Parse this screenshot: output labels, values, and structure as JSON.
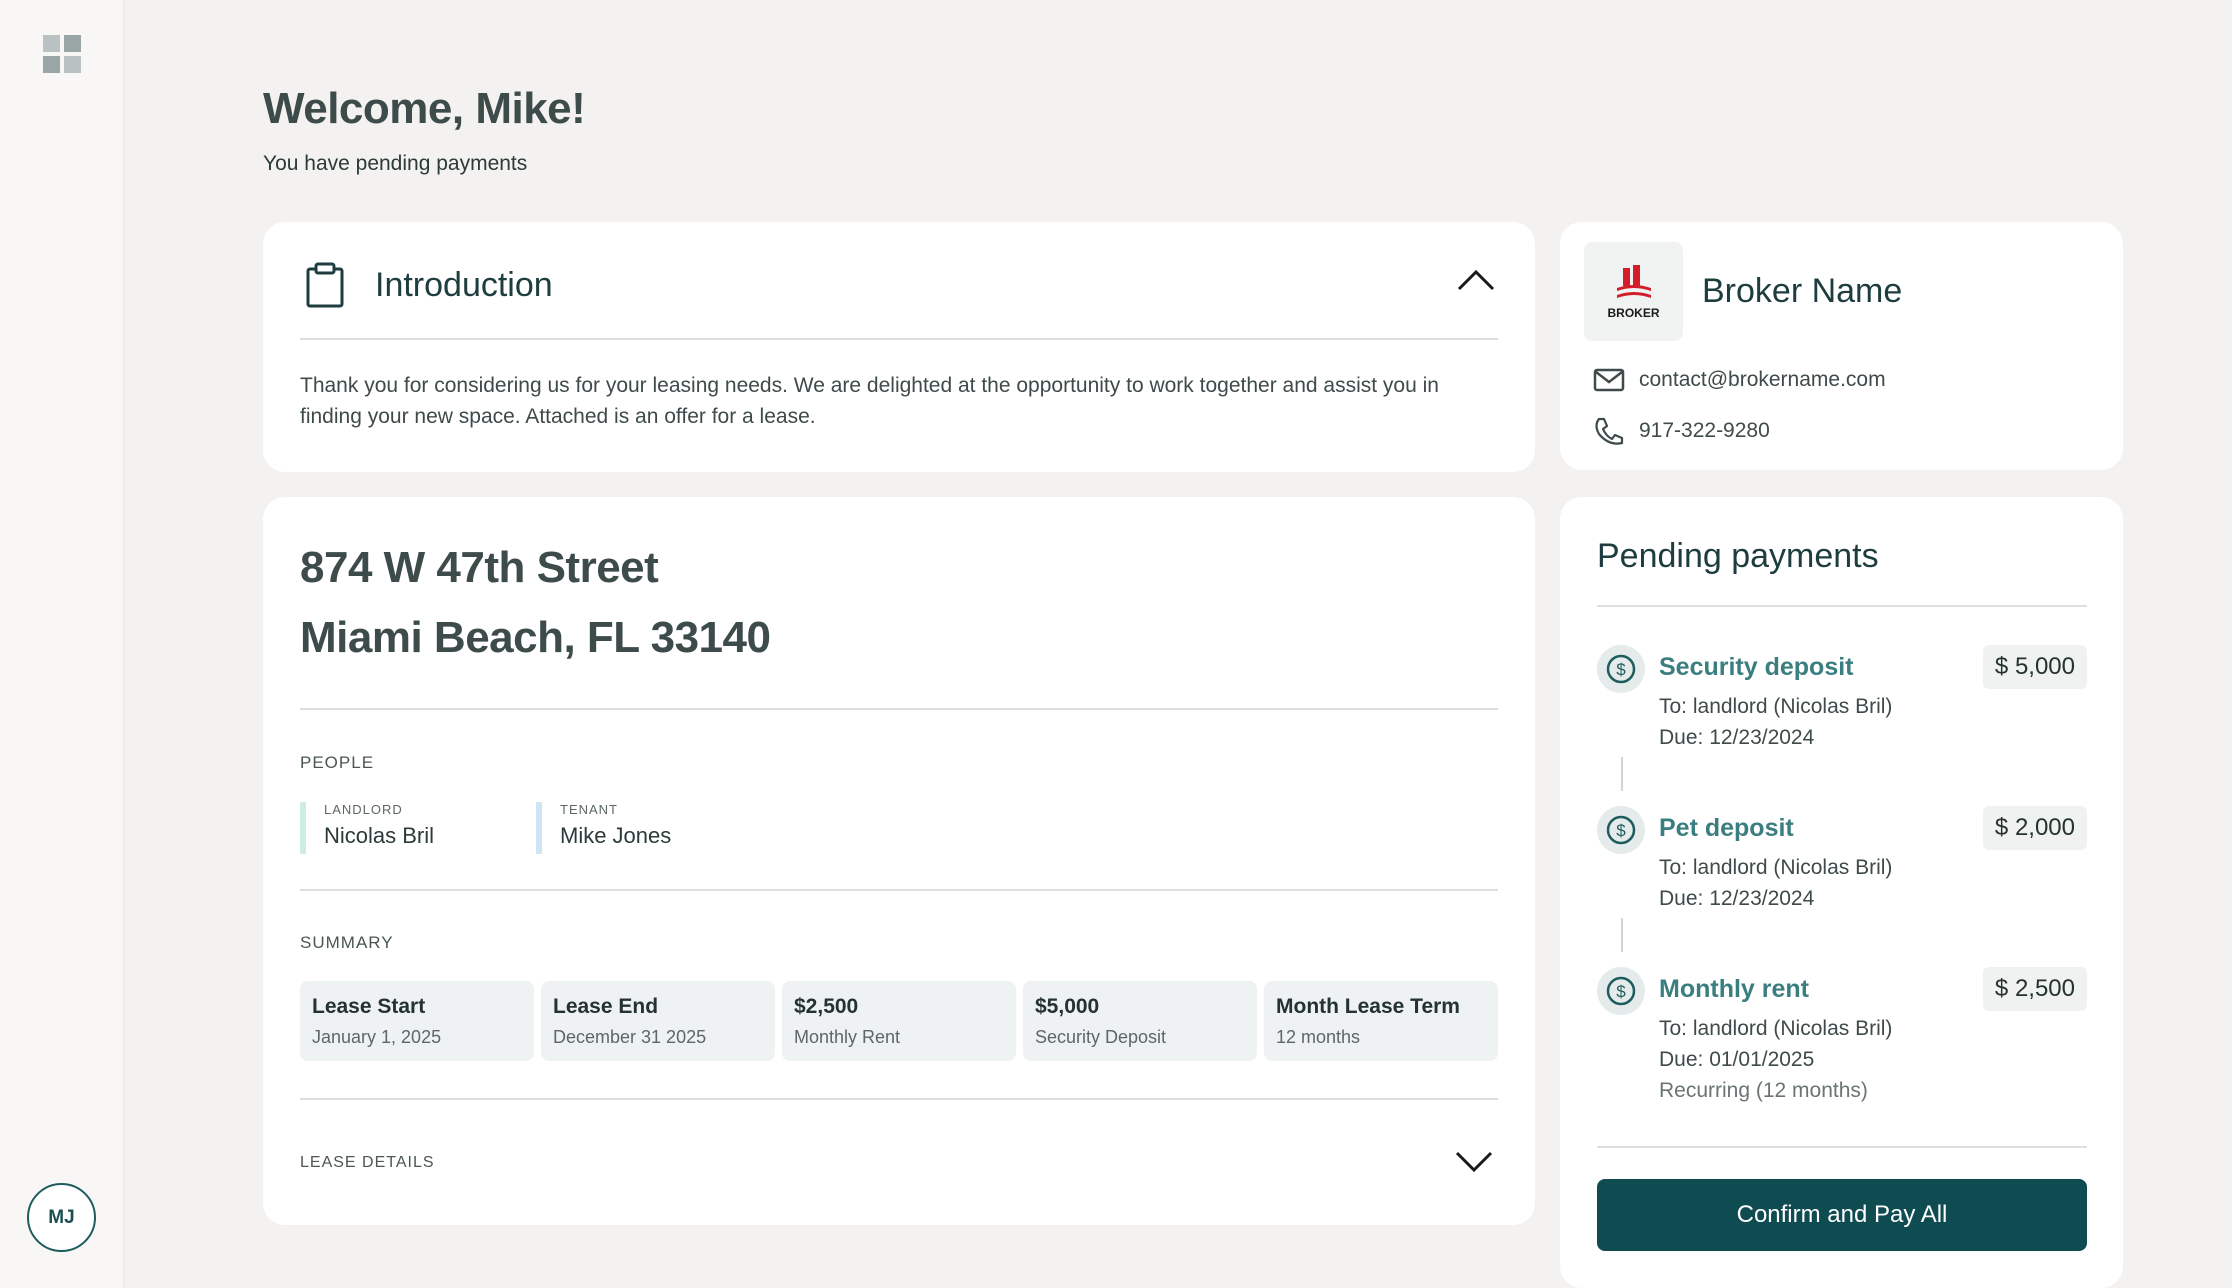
{
  "sidebar": {
    "avatar_initials": "MJ",
    "logo_icon": "app-logo-icon"
  },
  "header": {
    "welcome": "Welcome, Mike!",
    "subtitle": "You have pending payments"
  },
  "intro": {
    "title": "Introduction",
    "text": "Thank you for considering us for your leasing needs. We are delighted at the opportunity to work together and assist you in finding your new space. Attached is an offer for a lease.",
    "icon": "clipboard-icon"
  },
  "property": {
    "address_line1": "874 W 47th Street",
    "address_line2": "Miami Beach, FL 33140",
    "people_label": "PEOPLE",
    "people": [
      {
        "role": "LANDLORD",
        "name": "Nicolas Bril",
        "color": "#cdeee0"
      },
      {
        "role": "TENANT",
        "name": "Mike Jones",
        "color": "#cfe6f2"
      }
    ],
    "summary_label": "SUMMARY",
    "summary": [
      {
        "value": "Lease Start",
        "label": "January 1, 2025"
      },
      {
        "value": "Lease End",
        "label": "December 31 2025"
      },
      {
        "value": "$2,500",
        "label": "Monthly Rent"
      },
      {
        "value": "$5,000",
        "label": "Security Deposit"
      },
      {
        "value": "Month Lease Term",
        "label": "12 months"
      }
    ],
    "lease_details_label": "LEASE DETAILS"
  },
  "broker": {
    "name": "Broker Name",
    "logo_text": "BROKER",
    "email": "contact@brokername.com",
    "phone": "917-322-9280"
  },
  "payments": {
    "title": "Pending payments",
    "items": [
      {
        "name": "Security deposit",
        "amount": "$ 5,000",
        "to": "To: landlord (Nicolas Bril)",
        "due": "Due: 12/23/2024",
        "recurring": ""
      },
      {
        "name": "Pet deposit",
        "amount": "$ 2,000",
        "to": "To: landlord (Nicolas Bril)",
        "due": "Due: 12/23/2024",
        "recurring": ""
      },
      {
        "name": "Monthly rent",
        "amount": "$ 2,500",
        "to": "To: landlord (Nicolas Bril)",
        "due": "Due: 01/01/2025",
        "recurring": "Recurring (12 months)"
      }
    ],
    "button_label": "Confirm and Pay All"
  },
  "colors": {
    "accent": "#0e4c52",
    "payment_name": "#3b7e80",
    "background": "#f3f2f0"
  }
}
